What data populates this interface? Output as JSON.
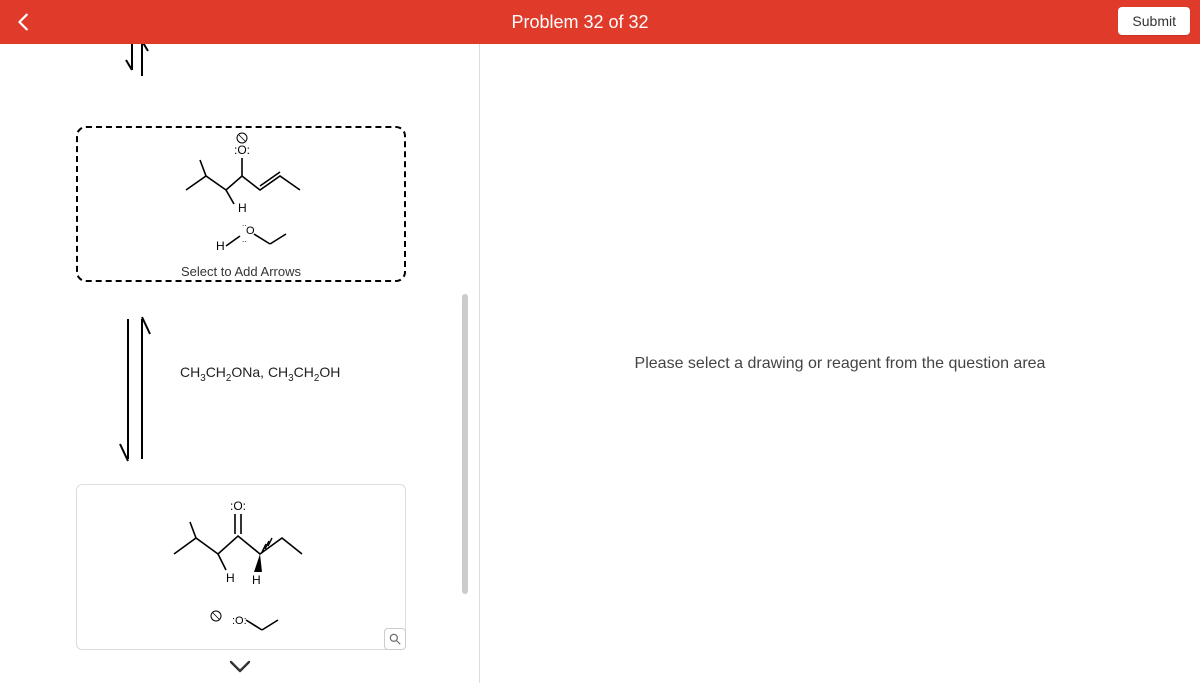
{
  "header": {
    "title": "Problem 32 of 32",
    "submit_label": "Submit"
  },
  "left": {
    "select_hint": "Select to Add Arrows",
    "reagent_html": "CH<sub>3</sub>CH<sub>2</sub>ONa, CH<sub>3</sub>CH<sub>2</sub>OH",
    "reagent_plain": "CH3CH2ONa, CH3CH2OH",
    "structure1": {
      "o_label": ":O:",
      "charge1": "⊖",
      "h_label1": "H",
      "o_label2": "O",
      "h_label2": "H"
    },
    "structure2": {
      "o_top": ":O:",
      "h1": "H",
      "h2": "H",
      "charge": "⊖",
      "o_bottom": ":O:"
    }
  },
  "right": {
    "placeholder": "Please select a drawing or reagent from the question area"
  }
}
